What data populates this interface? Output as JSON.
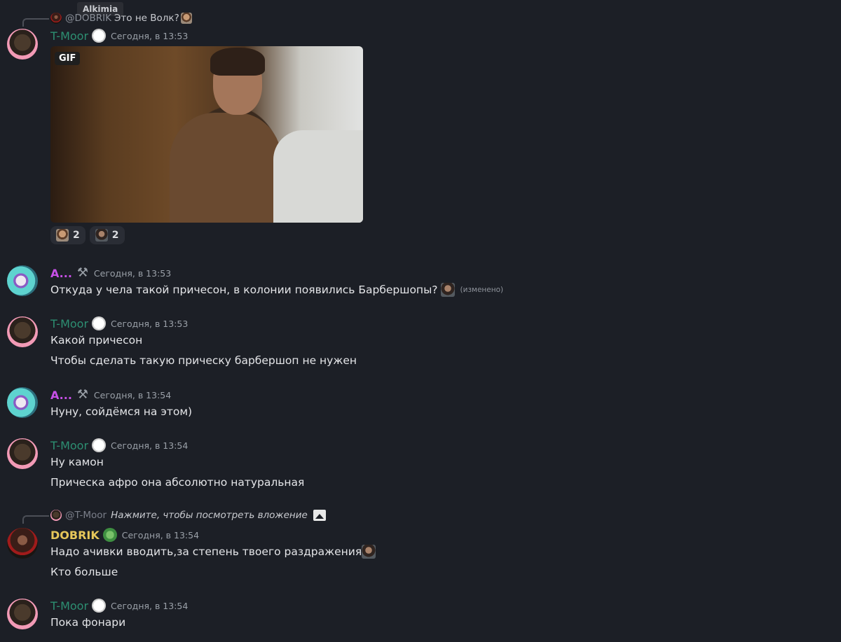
{
  "tooltip": "Alkimia",
  "messages": [
    {
      "reply": {
        "mention": "@DOBRIK",
        "text": "Это не Волк?"
      },
      "author": "T-Moor",
      "time": "Сегодня, в 13:53",
      "gif_label": "GIF",
      "reactions": [
        {
          "icon": "face-emoji",
          "count": "2"
        },
        {
          "icon": "dark-face-emoji",
          "count": "2"
        }
      ]
    },
    {
      "author": "A...",
      "time": "Сегодня, в 13:53",
      "lines": [
        "Откуда у чела такой причесон, в колонии появились Барбершопы?"
      ],
      "edited": "(изменено)"
    },
    {
      "author": "T-Moor",
      "time": "Сегодня, в 13:53",
      "lines": [
        "Какой причесон",
        "Чтобы сделать такую прическу барбершоп не нужен"
      ]
    },
    {
      "author": "A...",
      "time": "Сегодня, в 13:54",
      "lines": [
        "Нуну, сойдёмся на этом)"
      ]
    },
    {
      "author": "T-Moor",
      "time": "Сегодня, в 13:54",
      "lines": [
        "Ну камон",
        "Прическа афро она абсолютно натуральная"
      ]
    },
    {
      "reply": {
        "mention": "@T-Moor",
        "text": "Нажмите, чтобы посмотреть вложение"
      },
      "author": "DOBRIK",
      "time": "Сегодня, в 13:54",
      "lines": [
        "Надо ачивки вводить,за степень твоего раздражения",
        "Кто больше"
      ]
    },
    {
      "author": "T-Moor",
      "time": "Сегодня, в 13:54",
      "lines": [
        "Пока фонари"
      ]
    }
  ]
}
